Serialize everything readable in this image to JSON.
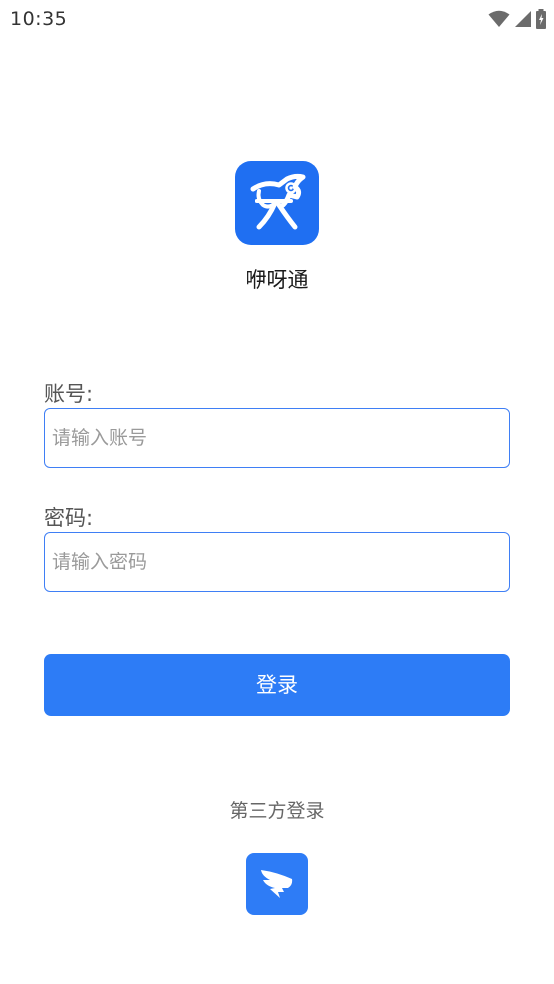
{
  "status_bar": {
    "time": "10:35",
    "icons": [
      "wifi-icon",
      "cellular-signal-icon",
      "battery-charging-icon"
    ]
  },
  "app": {
    "logo_icon": "app-logo-icon",
    "name": "咿呀通",
    "brand_color": "#1f6ff2"
  },
  "form": {
    "account_label": "账号:",
    "account_placeholder": "请输入账号",
    "account_value": "",
    "password_label": "密码:",
    "password_placeholder": "请输入密码",
    "password_value": "",
    "accent_color": "#3f7ff5"
  },
  "login_button": {
    "label": "登录",
    "color": "#2d7cf6"
  },
  "third_party": {
    "label": "第三方登录",
    "providers": [
      {
        "icon": "dingtalk-icon"
      }
    ]
  }
}
